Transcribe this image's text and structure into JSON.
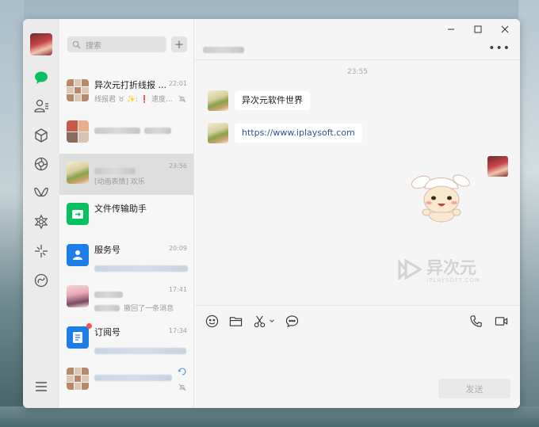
{
  "nav": {
    "icons": [
      "chat-icon",
      "contacts-icon",
      "favorites-cube-icon",
      "moments-icon",
      "channels-icon",
      "mini-program-icon",
      "search-spark-icon",
      "mini-apps-link-icon",
      "menu-icon"
    ]
  },
  "search": {
    "placeholder": "搜索",
    "add_label": "+"
  },
  "chats": [
    {
      "name": "异次元打折线报 ...",
      "time": "22:01",
      "preview": "线报君 ♉ ✨: ❗ 速度...",
      "muted": true
    },
    {
      "name": "",
      "time": "",
      "preview": ""
    },
    {
      "name": "",
      "time": "23:56",
      "preview": "[动画表情] 欢乐",
      "selected": true
    },
    {
      "name": "文件传输助手",
      "time": "",
      "preview": ""
    },
    {
      "name": "服务号",
      "time": "20:09",
      "preview": ""
    },
    {
      "name": "",
      "time": "17:41",
      "preview": "撤回了一条消息"
    },
    {
      "name": "订阅号",
      "time": "17:34",
      "preview": ""
    },
    {
      "name": "",
      "time": "",
      "preview": "",
      "muted": true
    }
  ],
  "chat": {
    "timestamp": "23:55",
    "messages": [
      {
        "from": "other",
        "text": "异次元软件世界"
      },
      {
        "from": "other",
        "text": "https://www.iplaysoft.com"
      },
      {
        "from": "me",
        "type": "sticker"
      }
    ],
    "watermark_main": "异次元",
    "watermark_sub": "IPLAYSOFT.COM",
    "send_label": "发送"
  },
  "colors": {
    "accent": "#07c160",
    "link": "#2a5599",
    "badge": "#fa5151"
  }
}
